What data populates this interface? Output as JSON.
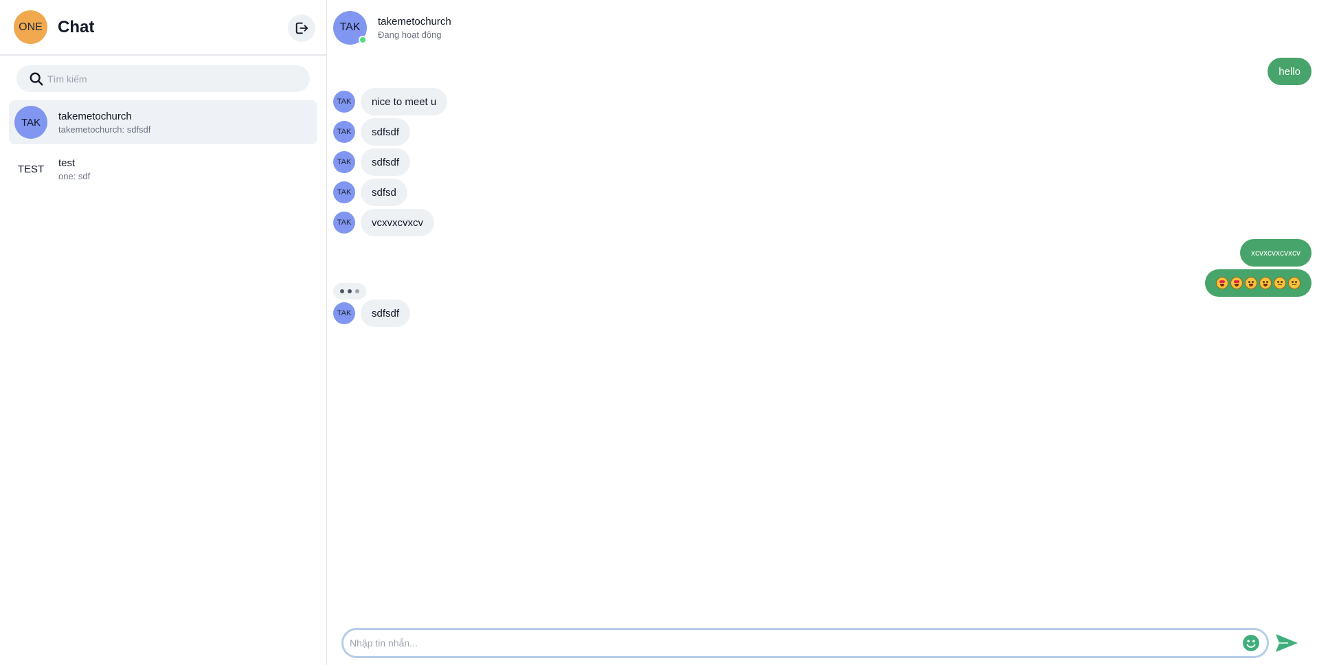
{
  "sidebar": {
    "me_avatar": "ONE",
    "title": "Chat",
    "logout_icon": "logout-icon",
    "search_placeholder": "Tìm kiếm",
    "conversations": [
      {
        "avatar": "TAK",
        "name": "takemetochurch",
        "last": "takemetochurch: sdfsdf",
        "active": true
      },
      {
        "avatar": "TEST",
        "name": "test",
        "last": "one: sdf",
        "active": false
      }
    ]
  },
  "chat": {
    "avatar": "TAK",
    "name": "takemetochurch",
    "status": "Đang hoạt động",
    "messages": [
      {
        "dir": "out",
        "text": "hello"
      },
      {
        "dir": "in",
        "avatar": "TAK",
        "text": "nice to meet u"
      },
      {
        "dir": "in",
        "avatar": "TAK",
        "text": "sdfsdf"
      },
      {
        "dir": "in",
        "avatar": "TAK",
        "text": "sdfsdf"
      },
      {
        "dir": "in",
        "avatar": "TAK",
        "text": "sdfsd"
      },
      {
        "dir": "in",
        "avatar": "TAK",
        "text": "vcxvxcvxcv"
      },
      {
        "dir": "out",
        "text": "xcvxcvxcvxcv"
      },
      {
        "dir": "out",
        "emoji": [
          "heart-eyes-emoji",
          "star-struck-emoji",
          "tongue-emoji",
          "grinning-emoji",
          "neutral-emoji",
          "slight-frown-emoji"
        ]
      },
      {
        "dir": "in",
        "avatar": "TAK",
        "text": "sdfsdf"
      }
    ],
    "composer_placeholder": "Nhập tin nhắn...",
    "emoji_icon": "smiley-icon",
    "send_icon": "send-icon"
  },
  "colors": {
    "accent_green": "#47a46a",
    "avatar_blue": "#8096f0",
    "avatar_orange": "#f0a94f",
    "online": "#4ade80"
  }
}
